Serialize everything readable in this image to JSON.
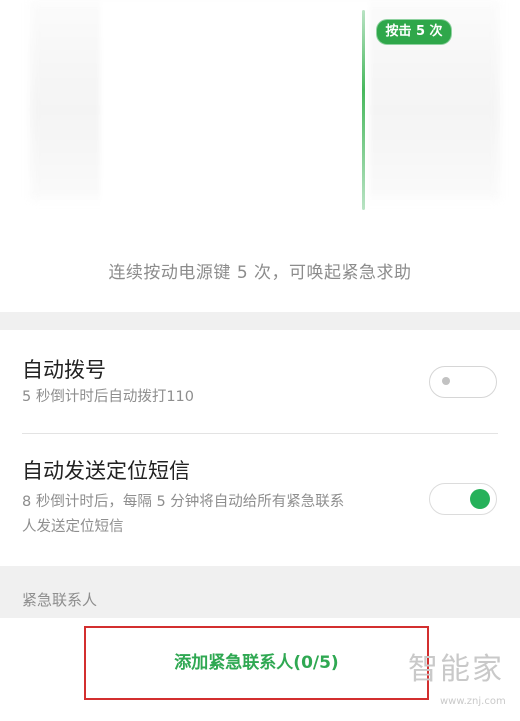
{
  "illustration": {
    "badge_label": "按击 5 次"
  },
  "tip": "连续按动电源键 5 次，可唤起紧急求助",
  "settings": {
    "auto_dial": {
      "title": "自动拨号",
      "subtitle": "5 秒倒计时后自动拨打110",
      "enabled": false
    },
    "auto_sms": {
      "title": "自动发送定位短信",
      "subtitle_line1": "8 秒倒计时后，每隔 5 分钟将自动给所有紧急联系",
      "subtitle_line2": "人发送定位短信",
      "enabled": true
    }
  },
  "contacts_section": {
    "header": "紧急联系人",
    "add_label": "添加紧急联系人(0/5)"
  },
  "watermark": {
    "text": "智能家",
    "url": "www.znj.com"
  },
  "colors": {
    "accent_green": "#26b15a",
    "highlight_red": "#d32f2f"
  }
}
